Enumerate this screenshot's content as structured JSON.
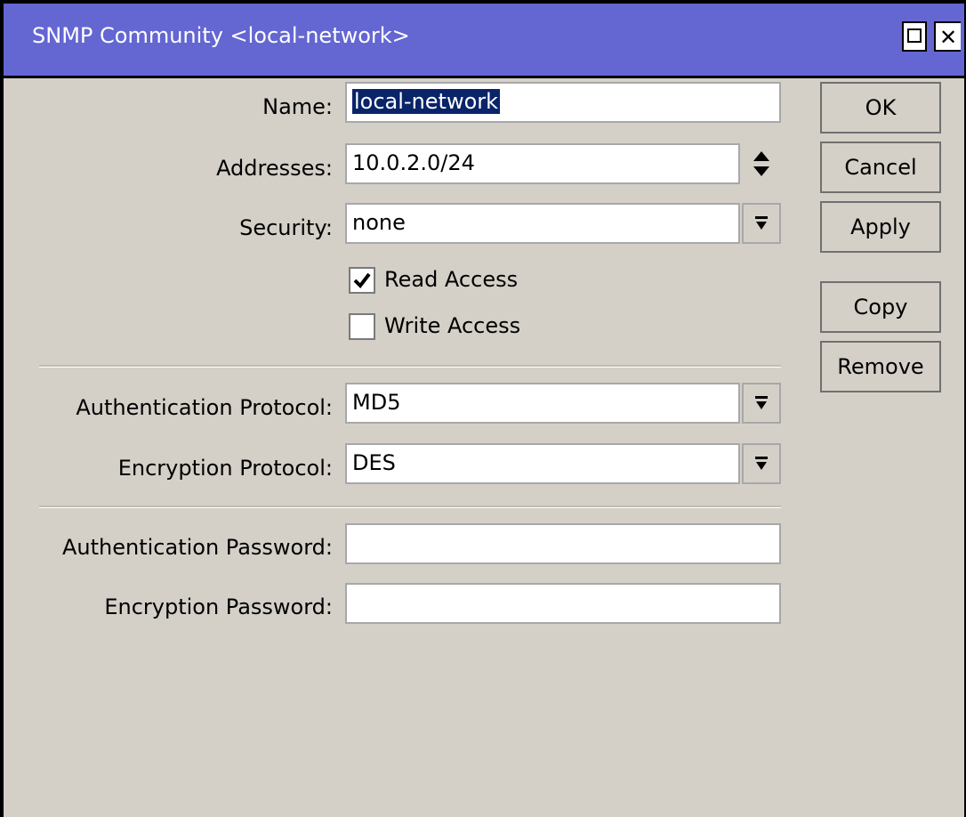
{
  "window": {
    "title": "SNMP Community <local-network>"
  },
  "form": {
    "name_label": "Name:",
    "name_value": "local-network",
    "addresses_label": "Addresses:",
    "addresses_value": "10.0.2.0/24",
    "security_label": "Security:",
    "security_value": "none",
    "read_access_label": "Read Access",
    "read_access_checked": true,
    "write_access_label": "Write Access",
    "write_access_checked": false,
    "auth_protocol_label": "Authentication Protocol:",
    "auth_protocol_value": "MD5",
    "enc_protocol_label": "Encryption Protocol:",
    "enc_protocol_value": "DES",
    "auth_password_label": "Authentication Password:",
    "auth_password_value": "",
    "enc_password_label": "Encryption Password:",
    "enc_password_value": ""
  },
  "buttons": {
    "ok": "OK",
    "cancel": "Cancel",
    "apply": "Apply",
    "copy": "Copy",
    "remove": "Remove"
  },
  "icons": {
    "maximize": "maximize-icon",
    "close": "close-icon",
    "dropdown": "dropdown-arrow-icon",
    "spinner": "up-down-spinner-icon",
    "checkmark": "checkmark-icon"
  },
  "colors": {
    "titlebar": "#6466d2",
    "window_bg": "#d4d0c8",
    "selection": "#0a246a"
  }
}
